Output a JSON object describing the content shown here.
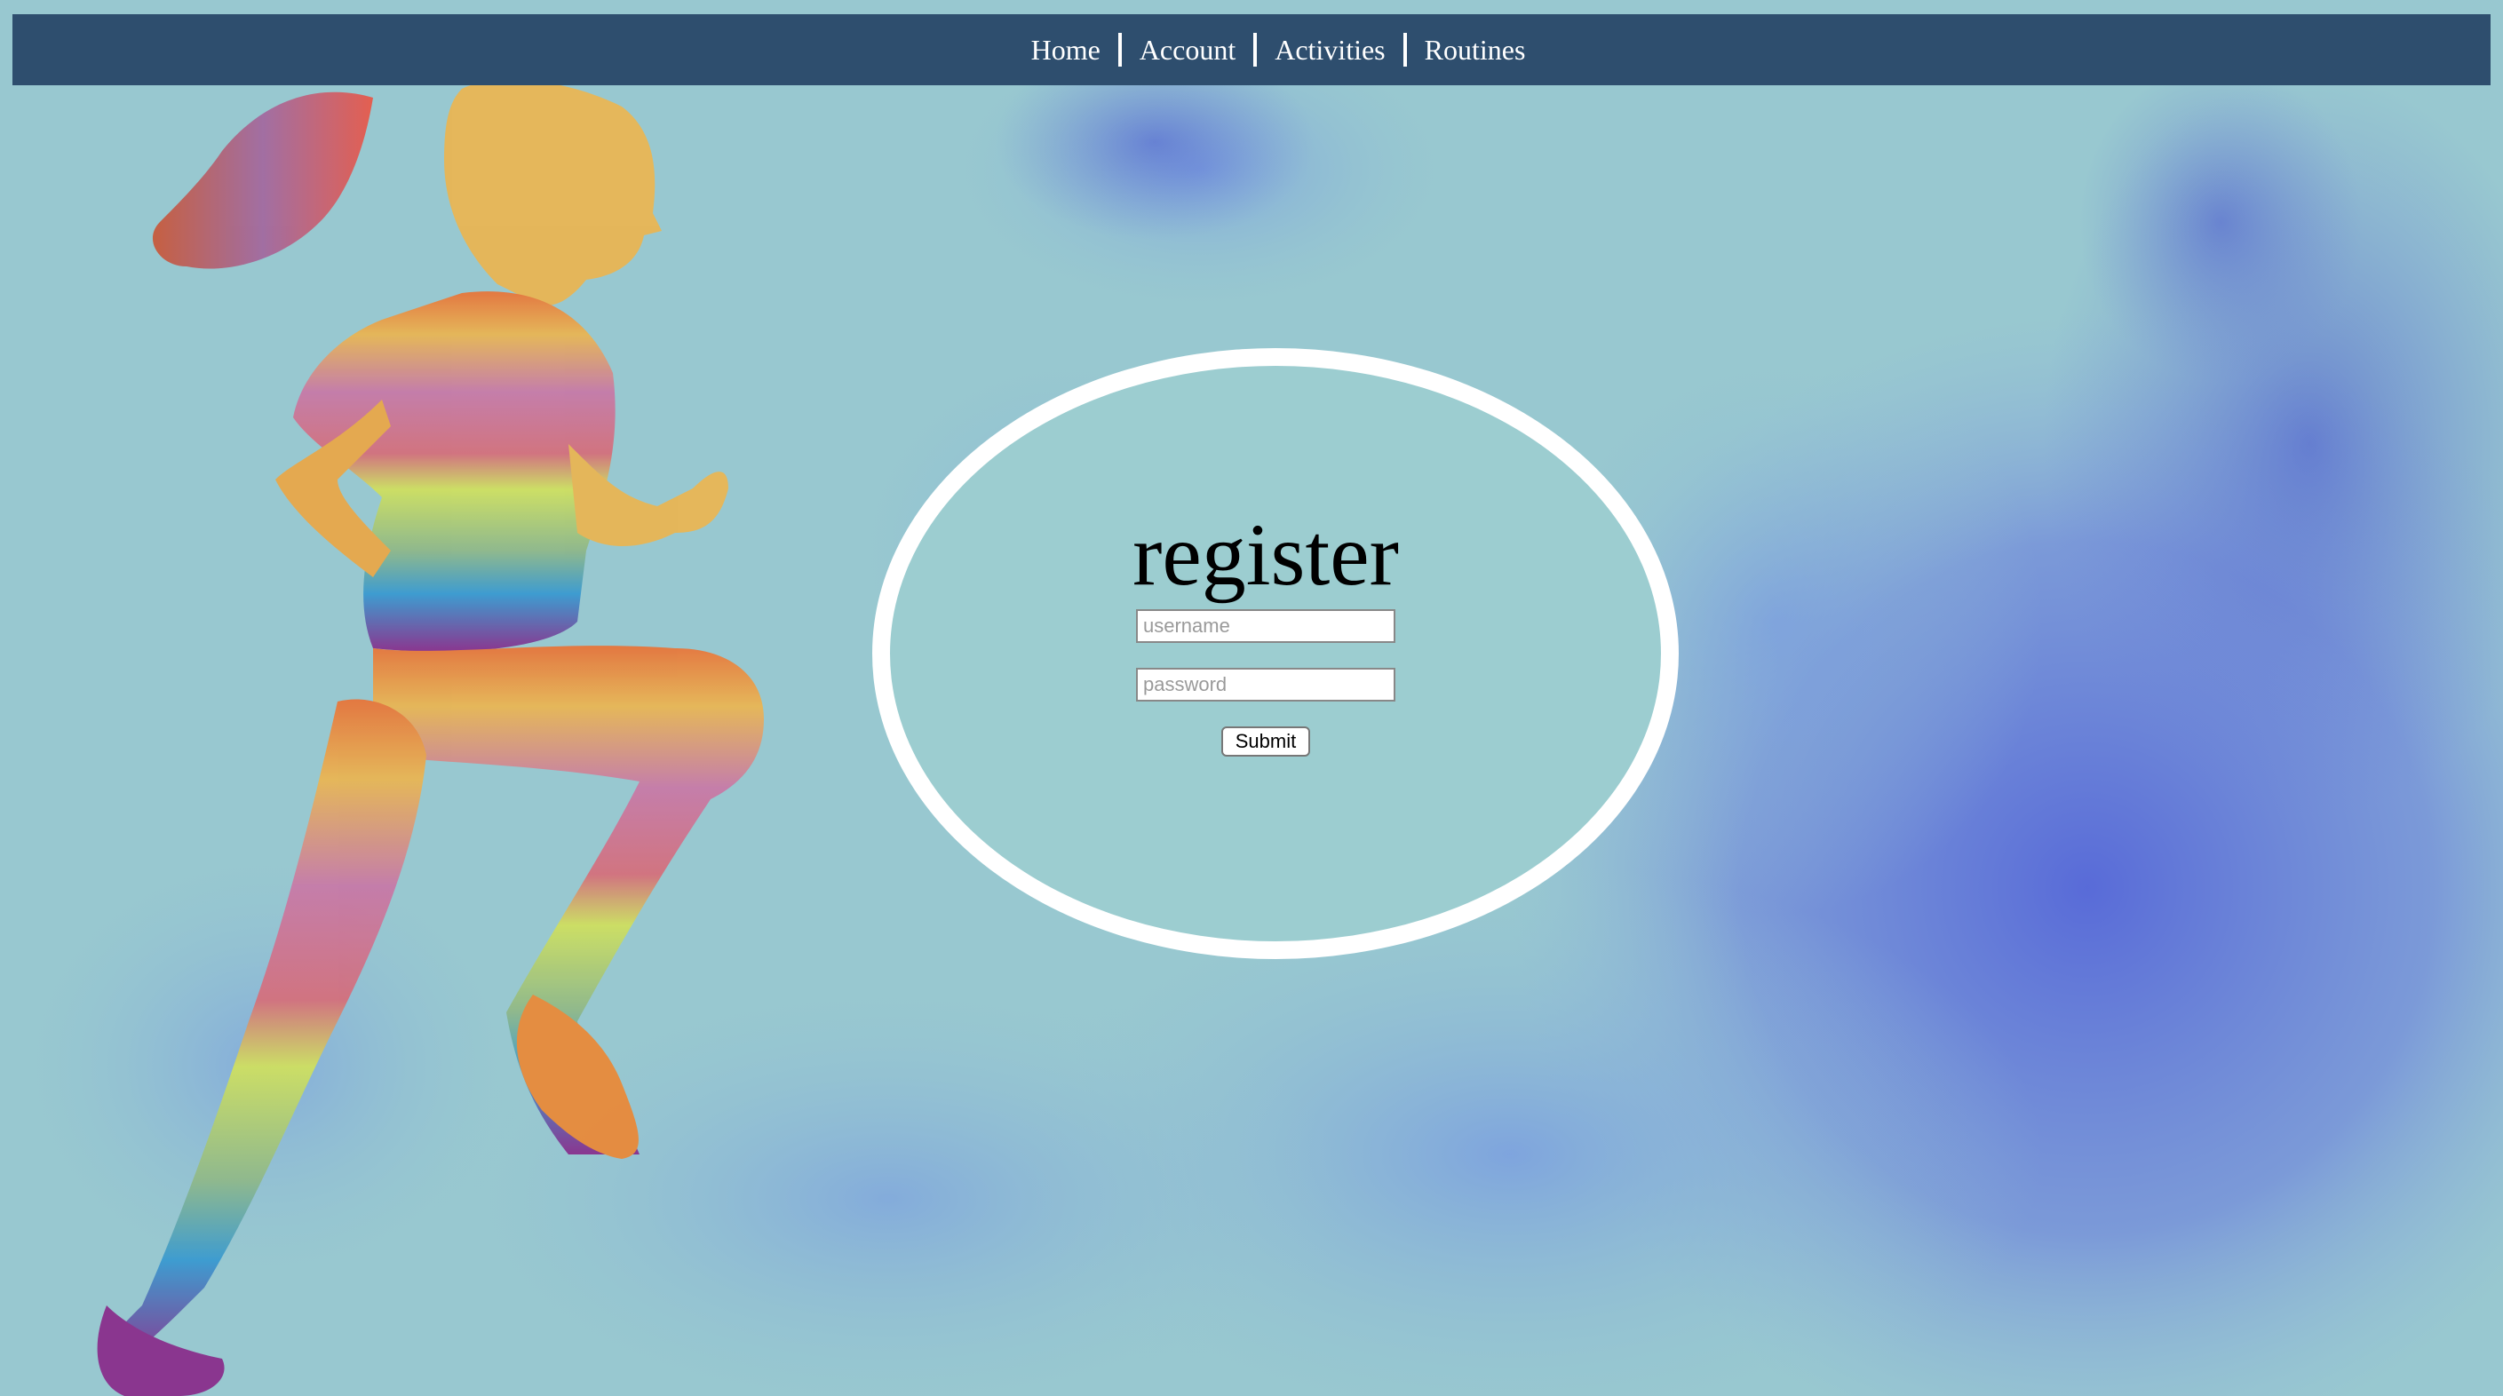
{
  "nav": {
    "items": [
      {
        "label": "Home"
      },
      {
        "label": "Account"
      },
      {
        "label": "Activities"
      },
      {
        "label": "Routines"
      }
    ]
  },
  "form": {
    "title": "register",
    "username_placeholder": "username",
    "password_placeholder": "password",
    "submit_label": "Submit"
  },
  "colors": {
    "navbar": "#2e4e6e",
    "background": "#98c8d0",
    "oval_fill": "#9ccdd0",
    "oval_border": "#ffffff"
  },
  "images": {
    "background_art": "blue-ink-smoke-cloud",
    "runner": "gradient-running-woman-silhouette"
  }
}
